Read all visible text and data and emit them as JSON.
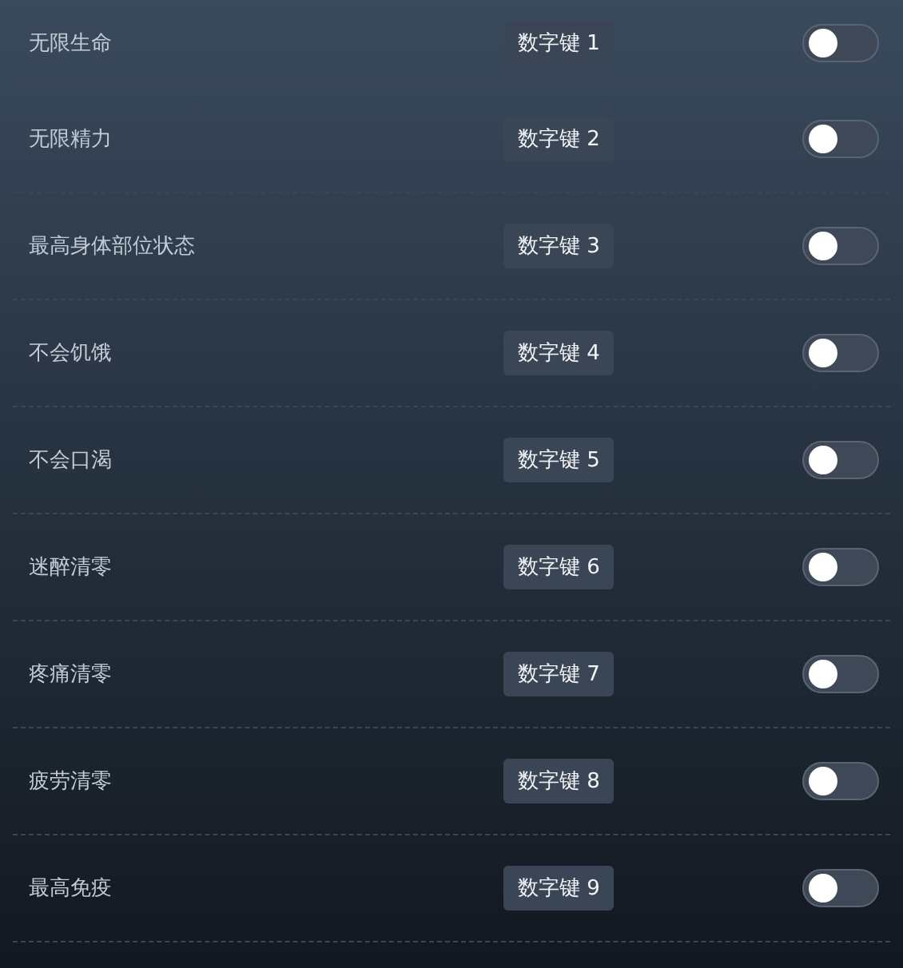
{
  "cheats": [
    {
      "label": "无限生命",
      "hotkey": "数字键 1",
      "on": false
    },
    {
      "label": "无限精力",
      "hotkey": "数字键 2",
      "on": false
    },
    {
      "label": "最高身体部位状态",
      "hotkey": "数字键 3",
      "on": false
    },
    {
      "label": "不会饥饿",
      "hotkey": "数字键 4",
      "on": false
    },
    {
      "label": "不会口渴",
      "hotkey": "数字键 5",
      "on": false
    },
    {
      "label": "迷醉清零",
      "hotkey": "数字键 6",
      "on": false
    },
    {
      "label": "疼痛清零",
      "hotkey": "数字键 7",
      "on": false
    },
    {
      "label": "疲劳清零",
      "hotkey": "数字键 8",
      "on": false
    },
    {
      "label": "最高免疫",
      "hotkey": "数字键 9",
      "on": false
    }
  ]
}
